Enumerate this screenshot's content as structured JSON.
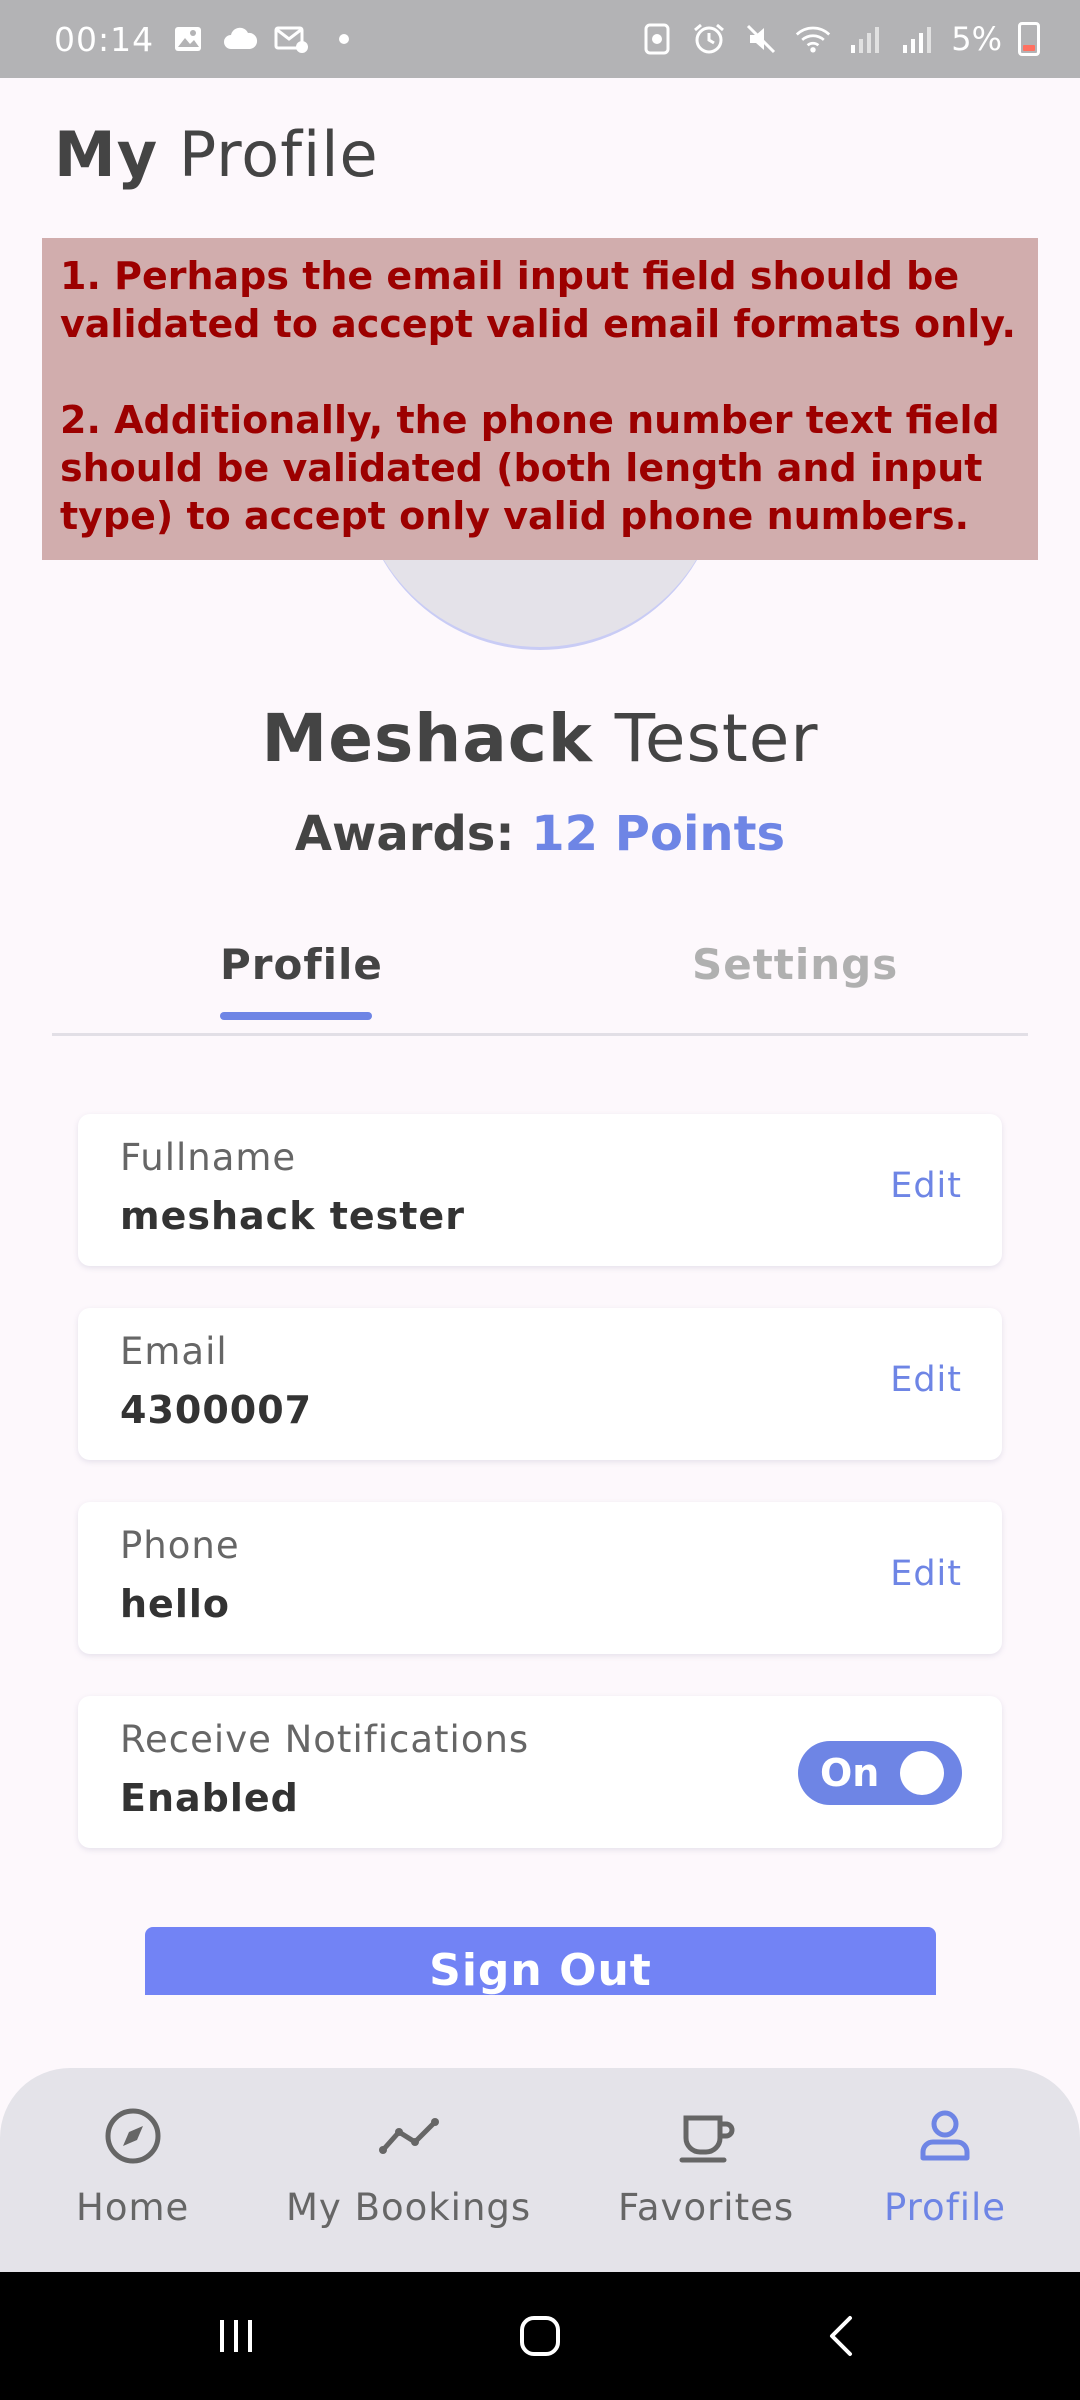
{
  "status_bar": {
    "time": "00:14",
    "battery": "5%"
  },
  "header": {
    "title_bold": "My",
    "title_rest": " Profile"
  },
  "annotation": {
    "line1": "1. Perhaps the email input field should be validated to accept valid email formats only.",
    "line2": "2. Additionally, the phone number text field should be validated (both length and input type) to accept only valid phone numbers."
  },
  "user": {
    "first_name": "Meshack",
    "last_name": " Tester",
    "awards_label": "Awards: ",
    "awards_value": "12 Points"
  },
  "tabs": {
    "profile": "Profile",
    "settings": "Settings"
  },
  "fields": {
    "fullname": {
      "label": "Fullname",
      "value": "meshack tester",
      "action": "Edit"
    },
    "email": {
      "label": "Email",
      "value": "4300007",
      "action": "Edit"
    },
    "phone": {
      "label": "Phone",
      "value": "hello",
      "action": "Edit"
    },
    "notifications": {
      "label": "Receive Notifications",
      "value": "Enabled",
      "toggle": "On"
    }
  },
  "sign_out": "Sign Out",
  "bottom_nav": {
    "home": "Home",
    "bookings": "My Bookings",
    "favorites": "Favorites",
    "profile": "Profile"
  },
  "colors": {
    "accent": "#6e85e5",
    "annotation_bg": "#d1adad",
    "annotation_text": "#9c0000"
  }
}
